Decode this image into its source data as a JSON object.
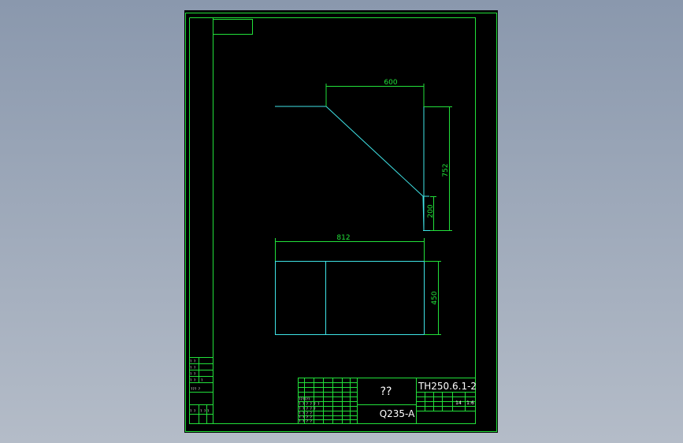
{
  "dimensions": {
    "top_width": "600",
    "total_height": "752",
    "bottom_height": "200",
    "rect_width": "812",
    "rect_height": "450"
  },
  "title_block": {
    "drawing_number": "TH250.6.1-2",
    "part_name": "??",
    "material": "Q235-A",
    "count": "14",
    "scale": "1:6"
  },
  "colors": {
    "background": "#000000",
    "frame": "#22e03a",
    "geometry": "#3fe3e6",
    "text": "#ffffff"
  }
}
